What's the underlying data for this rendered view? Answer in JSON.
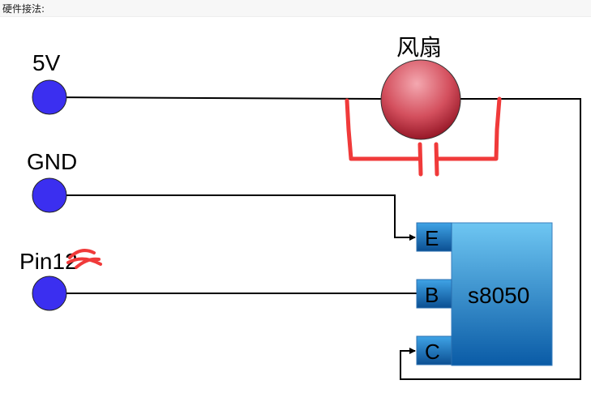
{
  "header": {
    "title": "硬件接法:"
  },
  "diagram": {
    "terminals": [
      {
        "label": "5V",
        "color": "#3b2ff0"
      },
      {
        "label": "GND",
        "color": "#3b2ff0"
      },
      {
        "label": "Pin12",
        "color": "#3b2ff0"
      }
    ],
    "fan": {
      "label": "风扇"
    },
    "transistor": {
      "name": "s8050",
      "pins": [
        "E",
        "B",
        "C"
      ]
    },
    "annotation_color": "#f03a3a"
  }
}
